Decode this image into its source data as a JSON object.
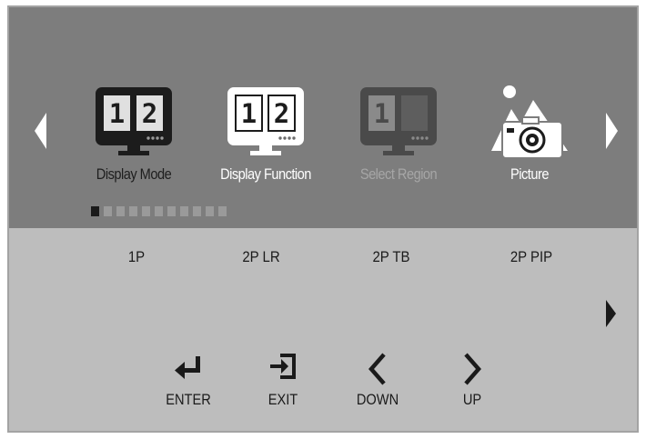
{
  "menu": {
    "items": [
      {
        "label": "Display Mode",
        "icon": "dual-monitor-dark-icon"
      },
      {
        "label": "Display Function",
        "icon": "dual-monitor-white-icon"
      },
      {
        "label": "Select Region",
        "icon": "single-region-monitor-icon"
      },
      {
        "label": "Picture",
        "icon": "picture-mountain-camera-icon"
      }
    ],
    "icon_text": {
      "one": "1",
      "two": "2"
    },
    "page_indicator": {
      "total": 11,
      "current": 1
    }
  },
  "options": [
    "1P",
    "2P LR",
    "2P TB",
    "2P PIP"
  ],
  "controls": [
    {
      "label": "ENTER",
      "icon": "enter-icon"
    },
    {
      "label": "EXIT",
      "icon": "exit-icon"
    },
    {
      "label": "DOWN",
      "icon": "chevron-left-icon"
    },
    {
      "label": "UP",
      "icon": "chevron-right-icon"
    }
  ],
  "colors": {
    "top_panel": "#7d7d7d",
    "bottom_panel": "#bdbdbd",
    "frame_border": "#a3a3a3",
    "active_dot": "#1a1a1a",
    "inactive_dot": "#9a9a9a"
  }
}
